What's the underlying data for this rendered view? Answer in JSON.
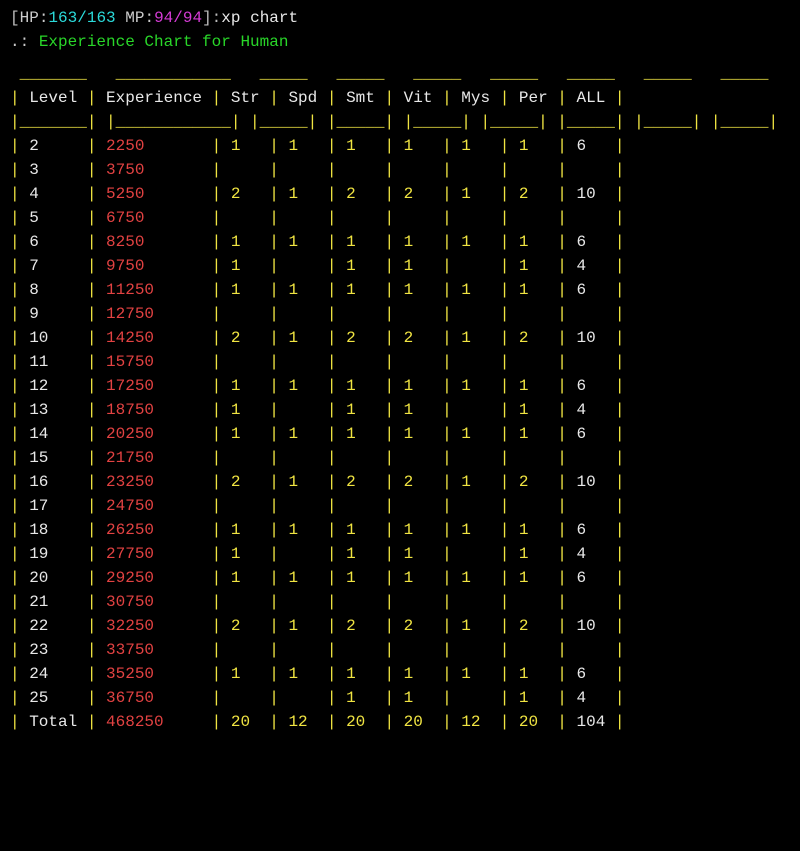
{
  "status": {
    "hp_label": "HP:",
    "hp_cur": "163",
    "hp_sep": "/",
    "hp_max": "163",
    "mp_label": " MP:",
    "mp_cur": "94",
    "mp_sep": "/",
    "mp_max": "94",
    "command": "xp chart"
  },
  "title": {
    "prefix": ".: ",
    "text": "Experience Chart for Human"
  },
  "headers": {
    "level": "Level",
    "experience": "Experience",
    "str": "Str",
    "spd": "Spd",
    "smt": "Smt",
    "vit": "Vit",
    "mys": "Mys",
    "per": "Per",
    "all": "ALL"
  },
  "box": {
    "top": " _______   ____________   _____   _____   _____   _____   _____   _____   _____ ",
    "bottom": "|_______| |____________| |_____| |_____| |_____| |_____| |_____| |_____| |_____|"
  },
  "rows": [
    {
      "level": "2",
      "xp": "2250",
      "str": "1",
      "spd": "1",
      "smt": "1",
      "vit": "1",
      "mys": "1",
      "per": "1",
      "all": "6"
    },
    {
      "level": "3",
      "xp": "3750",
      "str": "",
      "spd": "",
      "smt": "",
      "vit": "",
      "mys": "",
      "per": "",
      "all": ""
    },
    {
      "level": "4",
      "xp": "5250",
      "str": "2",
      "spd": "1",
      "smt": "2",
      "vit": "2",
      "mys": "1",
      "per": "2",
      "all": "10"
    },
    {
      "level": "5",
      "xp": "6750",
      "str": "",
      "spd": "",
      "smt": "",
      "vit": "",
      "mys": "",
      "per": "",
      "all": ""
    },
    {
      "level": "6",
      "xp": "8250",
      "str": "1",
      "spd": "1",
      "smt": "1",
      "vit": "1",
      "mys": "1",
      "per": "1",
      "all": "6"
    },
    {
      "level": "7",
      "xp": "9750",
      "str": "1",
      "spd": "",
      "smt": "1",
      "vit": "1",
      "mys": "",
      "per": "1",
      "all": "4"
    },
    {
      "level": "8",
      "xp": "11250",
      "str": "1",
      "spd": "1",
      "smt": "1",
      "vit": "1",
      "mys": "1",
      "per": "1",
      "all": "6"
    },
    {
      "level": "9",
      "xp": "12750",
      "str": "",
      "spd": "",
      "smt": "",
      "vit": "",
      "mys": "",
      "per": "",
      "all": ""
    },
    {
      "level": "10",
      "xp": "14250",
      "str": "2",
      "spd": "1",
      "smt": "2",
      "vit": "2",
      "mys": "1",
      "per": "2",
      "all": "10"
    },
    {
      "level": "11",
      "xp": "15750",
      "str": "",
      "spd": "",
      "smt": "",
      "vit": "",
      "mys": "",
      "per": "",
      "all": ""
    },
    {
      "level": "12",
      "xp": "17250",
      "str": "1",
      "spd": "1",
      "smt": "1",
      "vit": "1",
      "mys": "1",
      "per": "1",
      "all": "6"
    },
    {
      "level": "13",
      "xp": "18750",
      "str": "1",
      "spd": "",
      "smt": "1",
      "vit": "1",
      "mys": "",
      "per": "1",
      "all": "4"
    },
    {
      "level": "14",
      "xp": "20250",
      "str": "1",
      "spd": "1",
      "smt": "1",
      "vit": "1",
      "mys": "1",
      "per": "1",
      "all": "6"
    },
    {
      "level": "15",
      "xp": "21750",
      "str": "",
      "spd": "",
      "smt": "",
      "vit": "",
      "mys": "",
      "per": "",
      "all": ""
    },
    {
      "level": "16",
      "xp": "23250",
      "str": "2",
      "spd": "1",
      "smt": "2",
      "vit": "2",
      "mys": "1",
      "per": "2",
      "all": "10"
    },
    {
      "level": "17",
      "xp": "24750",
      "str": "",
      "spd": "",
      "smt": "",
      "vit": "",
      "mys": "",
      "per": "",
      "all": ""
    },
    {
      "level": "18",
      "xp": "26250",
      "str": "1",
      "spd": "1",
      "smt": "1",
      "vit": "1",
      "mys": "1",
      "per": "1",
      "all": "6"
    },
    {
      "level": "19",
      "xp": "27750",
      "str": "1",
      "spd": "",
      "smt": "1",
      "vit": "1",
      "mys": "",
      "per": "1",
      "all": "4"
    },
    {
      "level": "20",
      "xp": "29250",
      "str": "1",
      "spd": "1",
      "smt": "1",
      "vit": "1",
      "mys": "1",
      "per": "1",
      "all": "6"
    },
    {
      "level": "21",
      "xp": "30750",
      "str": "",
      "spd": "",
      "smt": "",
      "vit": "",
      "mys": "",
      "per": "",
      "all": ""
    },
    {
      "level": "22",
      "xp": "32250",
      "str": "2",
      "spd": "1",
      "smt": "2",
      "vit": "2",
      "mys": "1",
      "per": "2",
      "all": "10"
    },
    {
      "level": "23",
      "xp": "33750",
      "str": "",
      "spd": "",
      "smt": "",
      "vit": "",
      "mys": "",
      "per": "",
      "all": ""
    },
    {
      "level": "24",
      "xp": "35250",
      "str": "1",
      "spd": "1",
      "smt": "1",
      "vit": "1",
      "mys": "1",
      "per": "1",
      "all": "6"
    },
    {
      "level": "25",
      "xp": "36750",
      "str": "",
      "spd": "",
      "smt": "1",
      "vit": "1",
      "mys": "",
      "per": "1",
      "all": "4"
    },
    {
      "level": "Total",
      "xp": "468250",
      "str": "20",
      "spd": "12",
      "smt": "20",
      "vit": "20",
      "mys": "12",
      "per": "20",
      "all": "104"
    }
  ],
  "widths": {
    "level": 6,
    "experience": 11,
    "stat": 4,
    "all": 4
  }
}
